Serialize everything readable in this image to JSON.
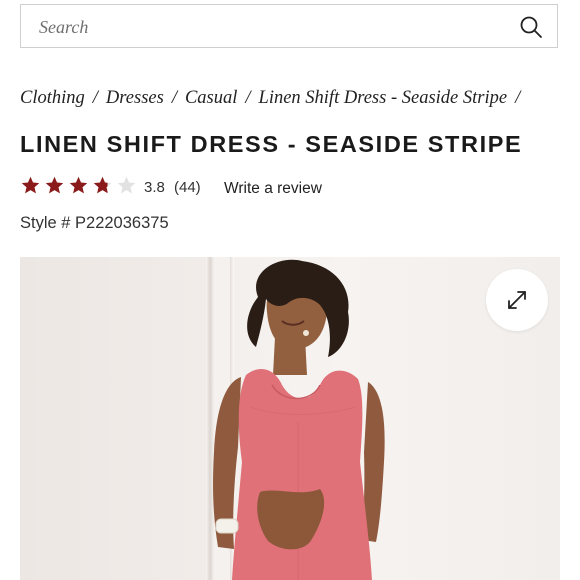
{
  "search": {
    "placeholder": "Search",
    "icon": "search-icon"
  },
  "breadcrumb": {
    "items": [
      "Clothing",
      "Dresses",
      "Casual",
      "Linen Shift Dress - Seaside Stripe"
    ],
    "separator": "/"
  },
  "product": {
    "title": "LINEN SHIFT DRESS - SEASIDE STRIPE",
    "rating": {
      "value": "3.8",
      "count": "(44)",
      "stars_filled": 3.8,
      "stars_total": 5,
      "star_color": "#8b1a1a",
      "star_empty_color": "#e2e2e2",
      "write_review_label": "Write a review"
    },
    "style_number": "Style # P222036375",
    "image": {
      "alt_icon": "expand-icon",
      "dress_color": "#e07178"
    }
  }
}
